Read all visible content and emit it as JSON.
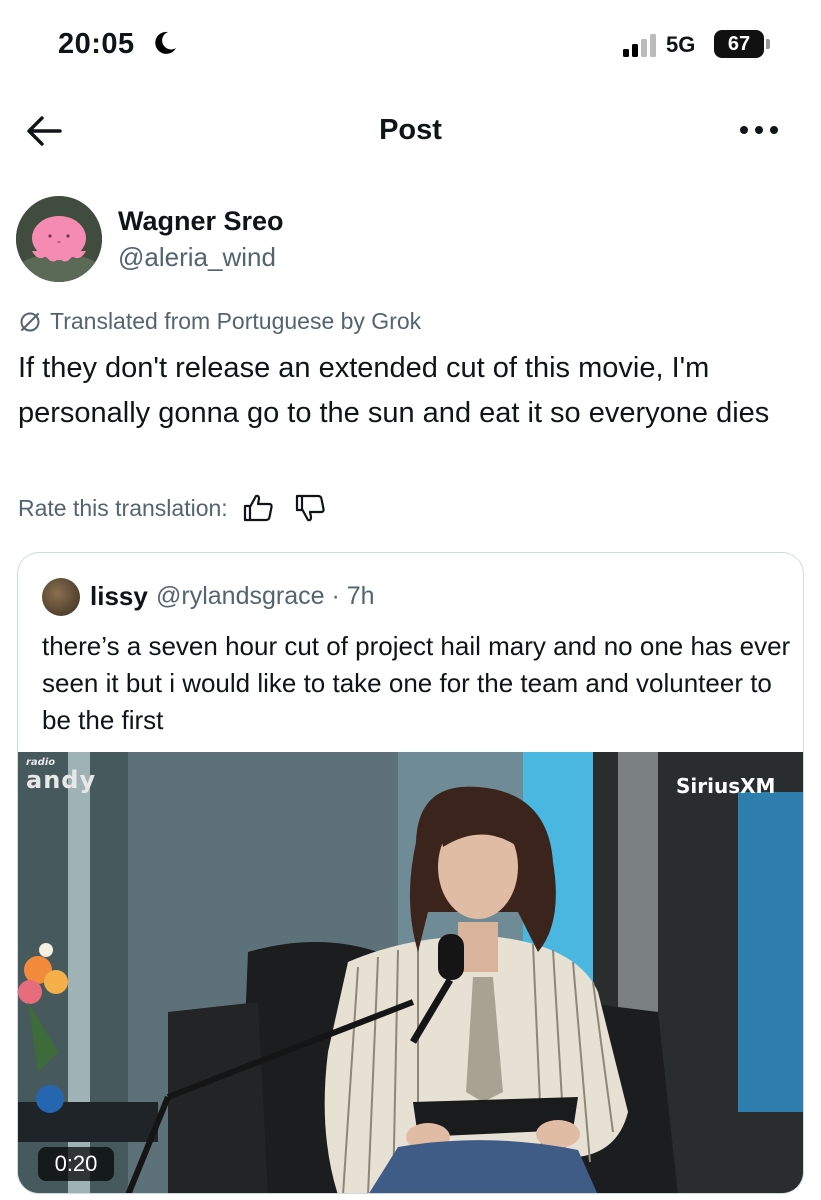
{
  "status_bar": {
    "time": "20:05",
    "network": "5G",
    "battery": "67"
  },
  "header": {
    "title": "Post"
  },
  "post": {
    "author_name": "Wagner Sreo",
    "author_handle": "@aleria_wind",
    "translation_notice": "Translated from Portuguese by Grok",
    "text": "If they don't release an extended cut of this movie, I'm personally gonna go to the sun and eat it so everyone dies",
    "rate_label": "Rate this translation:"
  },
  "quote": {
    "author_name": "lissy",
    "meta": "@rylandsgrace · 7h",
    "text": "there’s a seven hour cut of project hail mary and no one has ever seen it but i would like to take one for the team and volunteer to be the first",
    "video": {
      "logo_left_small": "radio",
      "logo_left_big": "andy",
      "logo_right": "SiriusXM",
      "duration": "0:20"
    }
  },
  "icons": {
    "back": "arrow-left-icon",
    "more": "more-horizontal-icon",
    "translate": "grok-slash-icon",
    "thumbs_up": "thumbs-up-icon",
    "thumbs_down": "thumbs-down-icon"
  },
  "colors": {
    "text_primary": "#0f1419",
    "text_secondary": "#536471",
    "border": "#cfd9de"
  }
}
